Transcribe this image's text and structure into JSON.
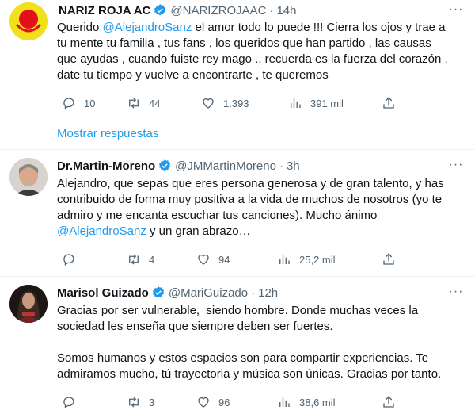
{
  "tweets": [
    {
      "name": "NARIZ ROJA AC",
      "handle": "@NARIZROJAAC",
      "time": "14h",
      "text_parts": [
        "Querido ",
        "@AlejandroSanz",
        " el amor todo lo puede !!! Cierra los ojos y trae a\ntu mente tu familia , tus fans , los queridos que han partido , las causas\nque ayudas , cuando fuiste rey mago .. recuerda es la fuerza del corazón ,\ndate tu tiempo y vuelve a encontrarte , te queremos"
      ],
      "replies": "10",
      "retweets": "44",
      "likes": "1.393",
      "views": "391 mil"
    },
    {
      "name": "Dr.Martin-Moreno",
      "handle": "@JMMartinMoreno",
      "time": "3h",
      "text_parts": [
        "Alejandro, que sepas que eres persona generosa y de gran talento, y has\ncontribuido de forma muy positiva a la vida de muchos de nosotros (yo te\nadmiro y me encanta escuchar tus canciones). Mucho ánimo\n",
        "@AlejandroSanz",
        " y un gran abrazo…"
      ],
      "replies": "",
      "retweets": "4",
      "likes": "94",
      "views": "25,2 mil"
    },
    {
      "name": "Marisol Guizado",
      "handle": "@MariGuizado",
      "time": "12h",
      "text_parts": [
        "Gracias por ser vulnerable,  siendo hombre. Donde muchas veces la\nsociedad les enseña que siempre deben ser fuertes.\n\nSomos humanos y estos espacios son para compartir experiencias. Te\nadmiramos mucho, tú trayectoria y música son únicas. Gracias por tanto."
      ],
      "replies": "",
      "retweets": "3",
      "likes": "96",
      "views": "38,6 mil"
    }
  ],
  "show_more_label": "Mostrar respuestas",
  "more_label": "···",
  "dot": "·",
  "colors": {
    "accent": "#1d9bf0",
    "muted": "#536471",
    "verified": "#1d9bf0"
  }
}
